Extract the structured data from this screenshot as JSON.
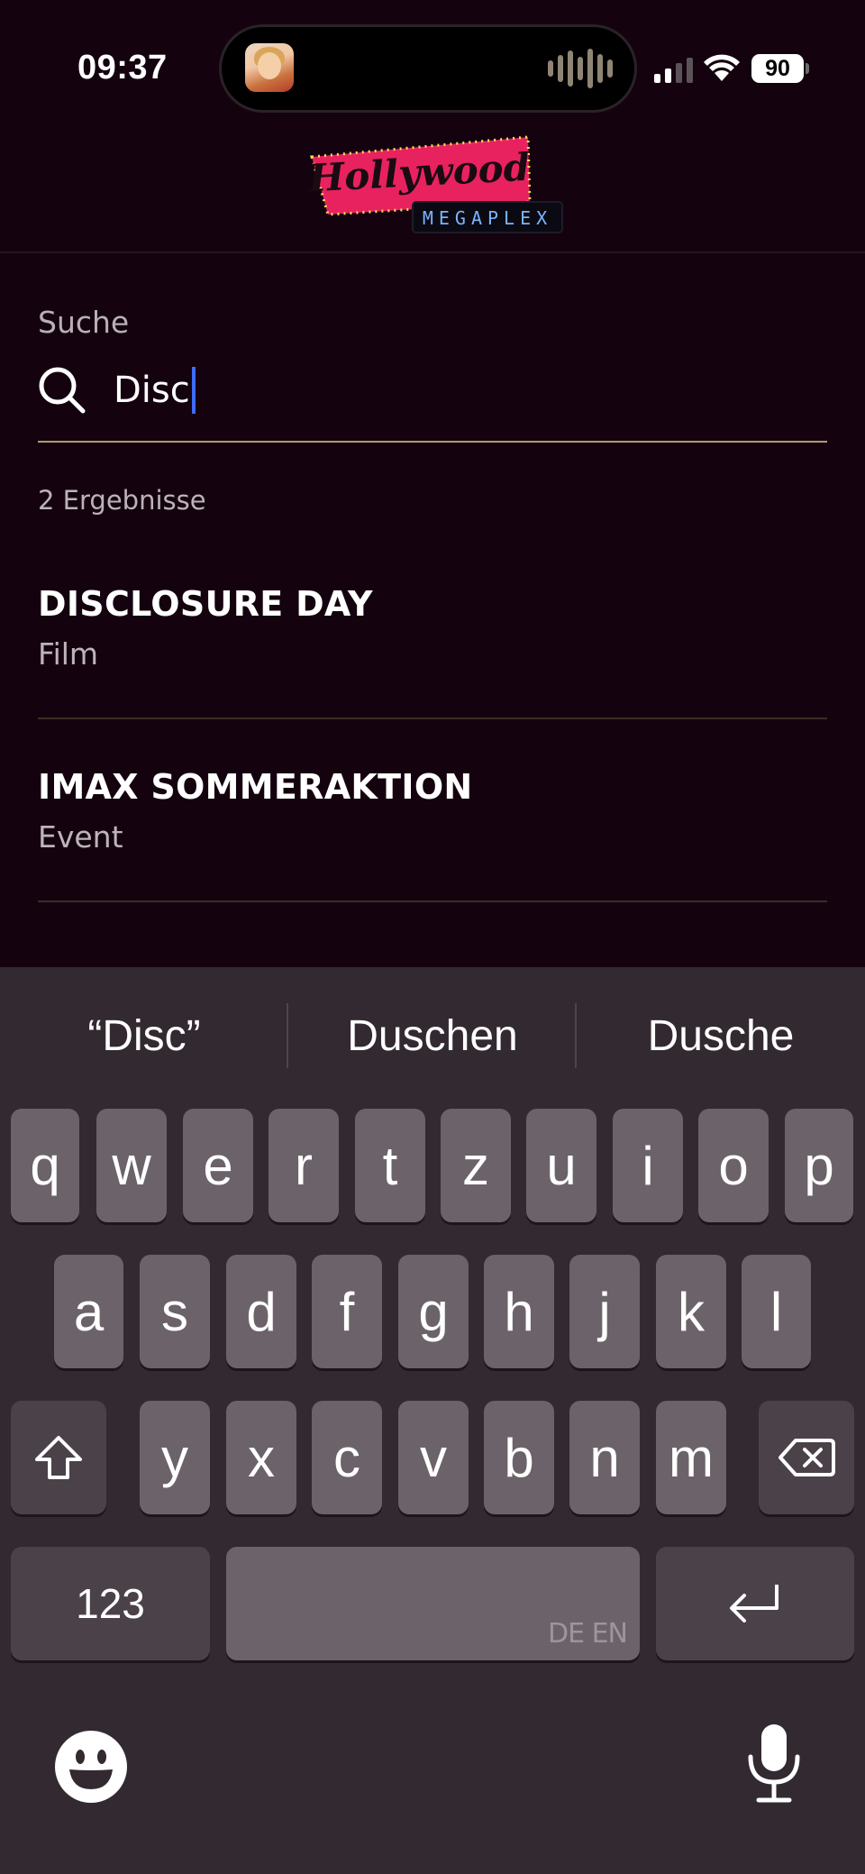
{
  "status_bar": {
    "time": "09:37",
    "battery": "90"
  },
  "app": {
    "logo_main": "Hollywood",
    "logo_sub": "MEGAPLEX"
  },
  "search": {
    "label": "Suche",
    "value": "Disc",
    "result_count": "2 Ergebnisse"
  },
  "results": [
    {
      "title": "DISCLOSURE DAY",
      "type": "Film"
    },
    {
      "title": "IMAX SOMMERAKTION",
      "type": "Event"
    }
  ],
  "keyboard": {
    "suggestions": [
      "“Disc”",
      "Duschen",
      "Dusche"
    ],
    "row1": [
      "q",
      "w",
      "e",
      "r",
      "t",
      "z",
      "u",
      "i",
      "o",
      "p"
    ],
    "row2": [
      "a",
      "s",
      "d",
      "f",
      "g",
      "h",
      "j",
      "k",
      "l"
    ],
    "row3": [
      "y",
      "x",
      "c",
      "v",
      "b",
      "n",
      "m"
    ],
    "numbers_label": "123",
    "space_hint": "DE EN"
  },
  "colors": {
    "background": "#14030f",
    "accent_underline": "#b49a6a",
    "caret": "#3f6bff",
    "logo_pink": "#e8225f"
  }
}
